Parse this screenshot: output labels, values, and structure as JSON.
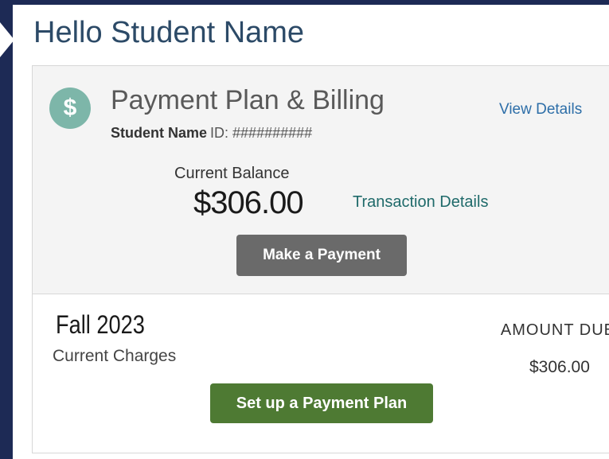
{
  "greeting": "Hello Student Name",
  "payment_panel": {
    "icon": "dollar-icon",
    "icon_glyph": "$",
    "title": "Payment Plan & Billing",
    "view_details": "View Details",
    "student_label": "Student Name",
    "student_id": "ID: ##########",
    "balance_label": "Current Balance",
    "balance_amount": "$306.00",
    "transaction_link": "Transaction Details",
    "make_payment": "Make a Payment",
    "colors": {
      "icon_bg": "#7db6a9",
      "title": "#595959",
      "link": "#2d6ea8",
      "pay_button": "#6a6a6a"
    }
  },
  "term_section": {
    "term": "Fall 2023",
    "charges_label": "Current Charges",
    "amount_due_header": "AMOUNT DUE",
    "amount_due_value": "$306.00",
    "plan_button": "Set up a Payment Plan",
    "colors": {
      "plan_button": "#4e7a33"
    }
  },
  "colors": {
    "frame": "#1d2a55",
    "greeting": "#2c4a67",
    "panel_bg": "#f4f4f4"
  }
}
